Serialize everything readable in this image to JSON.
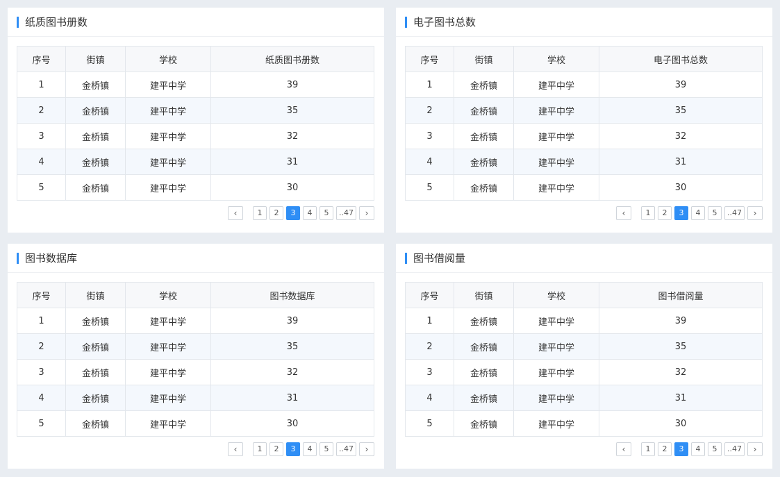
{
  "columns_common": [
    "序号",
    "街镇",
    "学校"
  ],
  "rows": [
    {
      "no": "1",
      "town": "金桥镇",
      "school": "建平中学",
      "value": "39"
    },
    {
      "no": "2",
      "town": "金桥镇",
      "school": "建平中学",
      "value": "35"
    },
    {
      "no": "3",
      "town": "金桥镇",
      "school": "建平中学",
      "value": "32"
    },
    {
      "no": "4",
      "town": "金桥镇",
      "school": "建平中学",
      "value": "31"
    },
    {
      "no": "5",
      "town": "金桥镇",
      "school": "建平中学",
      "value": "30"
    }
  ],
  "panels": [
    {
      "title": "纸质图书册数",
      "value_header": "纸质图书册数"
    },
    {
      "title": "电子图书总数",
      "value_header": "电子图书总数"
    },
    {
      "title": "图书数据库",
      "value_header": "图书数据库"
    },
    {
      "title": "图书借阅量",
      "value_header": "图书借阅量"
    }
  ],
  "pagination": {
    "prev": "‹",
    "next": "›",
    "pages": [
      "1",
      "2",
      "3",
      "4",
      "5",
      "..47"
    ],
    "active_page": "3"
  },
  "colors": {
    "accent": "#2f8ef5",
    "row_alt": "#f4f8fd",
    "header_bg": "#f7f8fa"
  }
}
